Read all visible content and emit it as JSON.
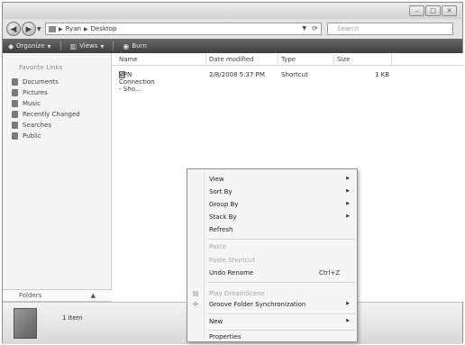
{
  "address_bar": {
    "crumbs": [
      "Ryan",
      "Desktop"
    ]
  },
  "search": {
    "placeholder": "Search"
  },
  "toolbar": {
    "organize": "Organize",
    "views": "Views",
    "burn": "Burn"
  },
  "favorites": {
    "title": "Favorite Links",
    "items": [
      {
        "label": "Documents",
        "icon": "documents-icon"
      },
      {
        "label": "Pictures",
        "icon": "pictures-icon"
      },
      {
        "label": "Music",
        "icon": "music-icon"
      },
      {
        "label": "Recently Changed",
        "icon": "recently-changed-icon"
      },
      {
        "label": "Searches",
        "icon": "searches-icon"
      },
      {
        "label": "Public",
        "icon": "public-icon"
      }
    ]
  },
  "folders_label": "Folders",
  "columns": [
    "Name",
    "Date modified",
    "Type",
    "Size"
  ],
  "files": [
    {
      "name": "VPN Connection - Sho...",
      "date": "2/8/2008 5:37 PM",
      "type": "Shortcut",
      "size": "1 KB"
    }
  ],
  "details": {
    "count": "1 item"
  },
  "context_menu": {
    "view": "View",
    "sort_by": "Sort By",
    "group_by": "Group By",
    "stack_by": "Stack By",
    "refresh": "Refresh",
    "paste": "Paste",
    "paste_shortcut": "Paste Shortcut",
    "undo_rename": "Undo Rename",
    "undo_shortcut": "Ctrl+Z",
    "play_dreamscene": "Play DreamScene",
    "groove": "Groove Folder Synchronization",
    "new": "New",
    "properties": "Properties"
  }
}
